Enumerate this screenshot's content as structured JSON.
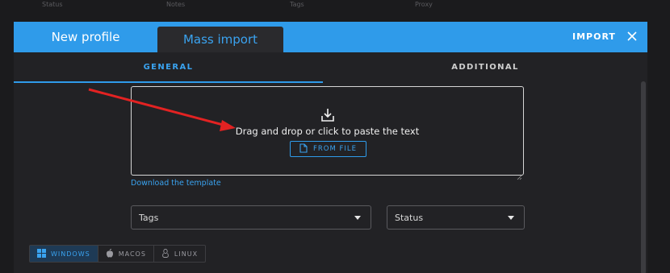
{
  "background_table": {
    "columns": [
      "Status",
      "Notes",
      "Tags",
      "Proxy"
    ]
  },
  "modal": {
    "tabs": {
      "new_profile": "New profile",
      "mass_import": "Mass import"
    },
    "import_label": "IMPORT",
    "close_icon": "close-icon",
    "subtabs": {
      "general": "GENERAL",
      "additional": "ADDITIONAL"
    },
    "dropzone": {
      "icon": "download-icon",
      "text": "Drag and drop or click to paste the text",
      "from_file_label": "FROM FILE",
      "from_file_icon": "file-icon"
    },
    "download_template_link": "Download the template",
    "tags_select": {
      "value": "Tags"
    },
    "status_select": {
      "value": "Status"
    },
    "os_buttons": [
      {
        "label": "WINDOWS",
        "icon": "windows-icon",
        "selected": true
      },
      {
        "label": "MACOS",
        "icon": "apple-icon",
        "selected": false
      },
      {
        "label": "LINUX",
        "icon": "linux-icon",
        "selected": false
      }
    ]
  },
  "colors": {
    "accent": "#2f9bea",
    "background": "#1b1b1d",
    "modal_background": "#222225",
    "annotation_arrow": "#e32222"
  }
}
